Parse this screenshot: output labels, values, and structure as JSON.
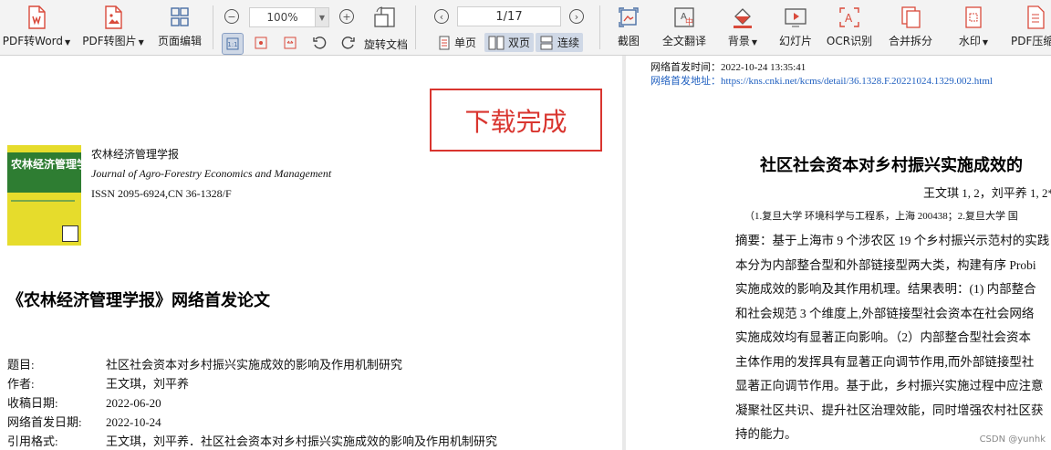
{
  "toolbar": {
    "pdf_to_word": "PDF转Word",
    "pdf_to_image": "PDF转图片",
    "page_edit": "页面编辑",
    "zoom": "100%",
    "rotate_doc": "旋转文档",
    "page_indicator": "1/17",
    "single_page": "单页",
    "double_page": "双页",
    "continuous": "连续",
    "screenshot": "截图",
    "full_translate": "全文翻译",
    "background": "背景",
    "slideshow": "幻灯片",
    "ocr": "OCR识别",
    "merge_split": "合并拆分",
    "watermark": "水印",
    "pdf_compress": "PDF压缩"
  },
  "left_page": {
    "stamp": "下载完成",
    "cover_title": "农林经济管理学报",
    "journal_cn": "农林经济管理学报",
    "journal_en": "Journal of Agro-Forestry Economics and Management",
    "issn": "ISSN 2095-6924,CN 36-1328/F",
    "heading": "《农林经济管理学报》网络首发论文",
    "meta": [
      {
        "k": "题目:",
        "v": "社区社会资本对乡村振兴实施成效的影响及作用机制研究"
      },
      {
        "k": "作者:",
        "v": "王文琪，刘平养"
      },
      {
        "k": "收稿日期:",
        "v": "2022-06-20"
      },
      {
        "k": "网络首发日期:",
        "v": "2022-10-24"
      },
      {
        "k": "引用格式:",
        "v": "王文琪，刘平养．社区社会资本对乡村振兴实施成效的影响及作用机制研究"
      }
    ]
  },
  "right_page": {
    "pub_time": "网络首发时间：2022-10-24 13:35:41",
    "pub_addr_label": "网络首发地址：",
    "pub_addr_url": "https://kns.cnki.net/kcms/detail/36.1328.F.20221024.1329.002.html",
    "title": "社区社会资本对乡村振兴实施成效的",
    "authors": "王文琪 1, 2，刘平养 1, 2*",
    "affil": "（1.复旦大学 环境科学与工程系，上海 200438；2.复旦大学 国",
    "abstract_lines": [
      "摘要：基于上海市 9 个涉农区 19 个乡村振兴示范村的实践",
      "本分为内部整合型和外部链接型两大类，构建有序 Probi",
      "实施成效的影响及其作用机理。结果表明：(1) 内部整合",
      "和社会规范 3 个维度上,外部链接型社会资本在社会网络",
      "实施成效均有显著正向影响。（2）内部整合型社会资本",
      "主体作用的发挥具有显著正向调节作用,而外部链接型社",
      "显著正向调节作用。基于此，乡村振兴实施过程中应注意",
      "凝聚社区共识、提升社区治理效能，同时增强农村社区获",
      "持的能力。"
    ],
    "watermark": "CSDN @yunhk"
  }
}
